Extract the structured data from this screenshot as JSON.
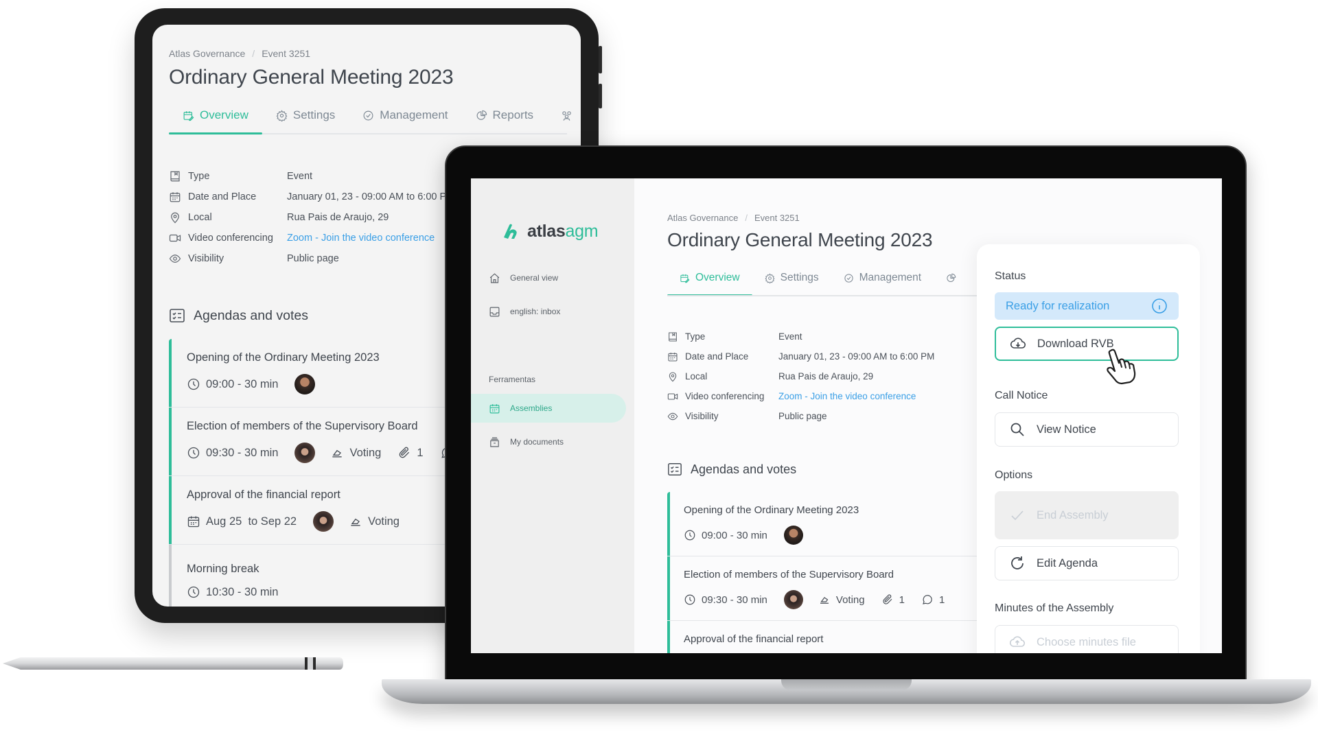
{
  "app": {
    "breadcrumb": [
      "Atlas Governance",
      "Event 3251"
    ],
    "title": "Ordinary General Meeting 2023",
    "tabs": [
      {
        "label": "Overview",
        "icon": "calendar-edit-icon",
        "active": true
      },
      {
        "label": "Settings",
        "icon": "gear-icon",
        "active": false
      },
      {
        "label": "Management",
        "icon": "check-circle-icon",
        "active": false
      },
      {
        "label": "Reports",
        "icon": "pie-chart-icon",
        "active": false
      }
    ],
    "info": [
      {
        "icon": "bookmark-book-icon",
        "label": "Type",
        "value": "Event"
      },
      {
        "icon": "calendar-icon",
        "label": "Date and Place",
        "value": "January 01, 23 - 09:00 AM to 6:00 PM"
      },
      {
        "icon": "map-pin-icon",
        "label": "Local",
        "value": "Rua Pais de Araujo, 29"
      },
      {
        "icon": "video-camera-icon",
        "label": "Video conferencing",
        "value": "Zoom - Join the video conference",
        "link": true
      },
      {
        "icon": "eye-icon",
        "label": "Visibility",
        "value": "Public page"
      }
    ],
    "agenda_heading": "Agendas and votes",
    "agenda": [
      {
        "title": "Opening of the Ordinary Meeting 2023",
        "time": "09:00 - 30 min"
      },
      {
        "title": "Election of members of the Supervisory Board",
        "time": "09:30 - 30 min",
        "voting": "Voting",
        "attachments": "1",
        "comments": "1"
      },
      {
        "title": "Approval of the financial report",
        "dates": "Aug 25  to Sep 22",
        "voting": "Voting"
      },
      {
        "title": "Morning break",
        "time": "10:30 - 30 min"
      }
    ]
  },
  "sidebar": {
    "logo_bold": "atlas",
    "logo_light": "agm",
    "items": [
      {
        "label": "General view",
        "icon": "home-icon"
      },
      {
        "label": "english: inbox",
        "icon": "inbox-icon"
      }
    ],
    "section": "Ferramentas",
    "tools": [
      {
        "label": "Assemblies",
        "icon": "calendar-icon",
        "active": true
      },
      {
        "label": "My documents",
        "icon": "archive-icon"
      }
    ]
  },
  "panel": {
    "status_label": "Status",
    "status_value": "Ready for realization",
    "download_label": "Download RVB",
    "call_notice_label": "Call Notice",
    "view_notice_label": "View Notice",
    "options_label": "Options",
    "end_assembly_label": "End Assembly",
    "edit_agenda_label": "Edit Agenda",
    "minutes_label": "Minutes of the Assembly",
    "choose_minutes_label": "Choose minutes file"
  },
  "colors": {
    "accent": "#2ebd99",
    "link": "#3a9fe6",
    "status_bg": "#d4e9fb"
  }
}
